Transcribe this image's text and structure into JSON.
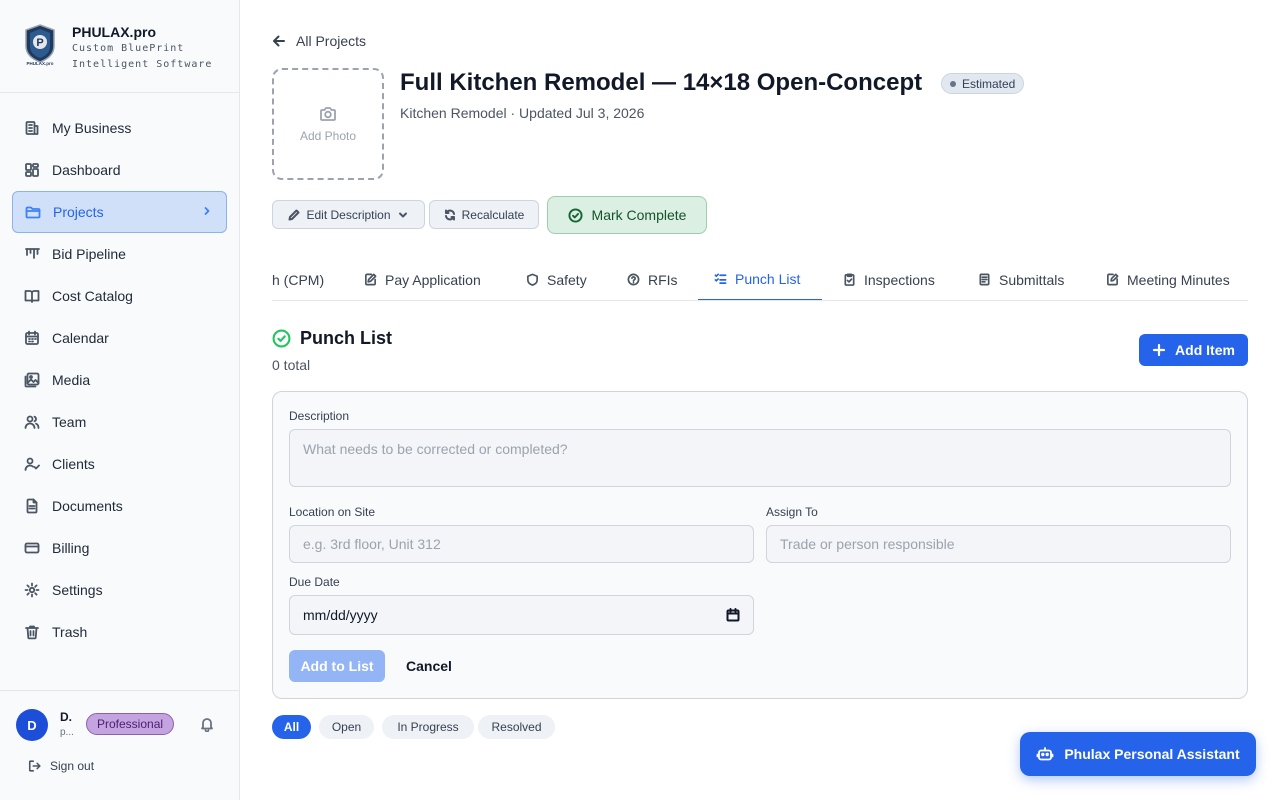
{
  "brand": {
    "name": "PHULAX.pro",
    "tagline_1": "Custom BluePrint",
    "tagline_2": "Intelligent Software",
    "logo_letter": "P",
    "logo_caption": "PHULAX.pro"
  },
  "sidebar": {
    "items": [
      {
        "label": "My Business",
        "icon": "building-icon"
      },
      {
        "label": "Dashboard",
        "icon": "dashboard-icon"
      },
      {
        "label": "Projects",
        "icon": "folder-icon",
        "active": true
      },
      {
        "label": "Bid Pipeline",
        "icon": "pipeline-icon"
      },
      {
        "label": "Cost Catalog",
        "icon": "book-icon"
      },
      {
        "label": "Calendar",
        "icon": "calendar-icon"
      },
      {
        "label": "Media",
        "icon": "image-icon"
      },
      {
        "label": "Team",
        "icon": "users-icon"
      },
      {
        "label": "Clients",
        "icon": "user-check-icon"
      },
      {
        "label": "Documents",
        "icon": "document-icon"
      },
      {
        "label": "Billing",
        "icon": "credit-card-icon"
      },
      {
        "label": "Settings",
        "icon": "gear-icon"
      },
      {
        "label": "Trash",
        "icon": "trash-icon"
      }
    ]
  },
  "user": {
    "initial": "D",
    "name": "D.",
    "sub": "p...",
    "plan": "Professional",
    "signout": "Sign out"
  },
  "header": {
    "back_label": "All Projects",
    "add_photo": "Add Photo",
    "title": "Full Kitchen Remodel — 14×18 Open-Concept",
    "status": "Estimated",
    "subtitle": "Kitchen Remodel · Updated Jul 3, 2026"
  },
  "actions": {
    "edit_description": "Edit Description",
    "recalculate": "Recalculate",
    "mark_complete": "Mark Complete"
  },
  "tabs": [
    {
      "label": "h (CPM)",
      "icon": ""
    },
    {
      "label": "Pay Application",
      "icon": "edit-doc-icon"
    },
    {
      "label": "Safety",
      "icon": "shield-icon"
    },
    {
      "label": "RFIs",
      "icon": "help-circle-icon"
    },
    {
      "label": "Punch List",
      "icon": "checklist-icon",
      "active": true
    },
    {
      "label": "Inspections",
      "icon": "clipboard-check-icon"
    },
    {
      "label": "Submittals",
      "icon": "file-text-icon"
    },
    {
      "label": "Meeting Minutes",
      "icon": "file-edit-icon"
    }
  ],
  "punch": {
    "title": "Punch List",
    "count": "0 total",
    "add_item": "Add Item"
  },
  "form": {
    "description_label": "Description",
    "description_placeholder": "What needs to be corrected or completed?",
    "location_label": "Location on Site",
    "location_placeholder": "e.g. 3rd floor, Unit 312",
    "assign_label": "Assign To",
    "assign_placeholder": "Trade or person responsible",
    "due_label": "Due Date",
    "due_value": "mm/dd/yyyy",
    "add_to_list": "Add to List",
    "cancel": "Cancel"
  },
  "filters": [
    {
      "label": "All",
      "active": true
    },
    {
      "label": "Open"
    },
    {
      "label": "In Progress"
    },
    {
      "label": "Resolved"
    }
  ],
  "assistant": {
    "label": "Phulax Personal Assistant"
  },
  "colors": {
    "accent": "#2563eb",
    "active_nav_bg": "#cfe0f8",
    "complete_green": "#dcefe3",
    "plan_badge": "#c4a4df"
  }
}
